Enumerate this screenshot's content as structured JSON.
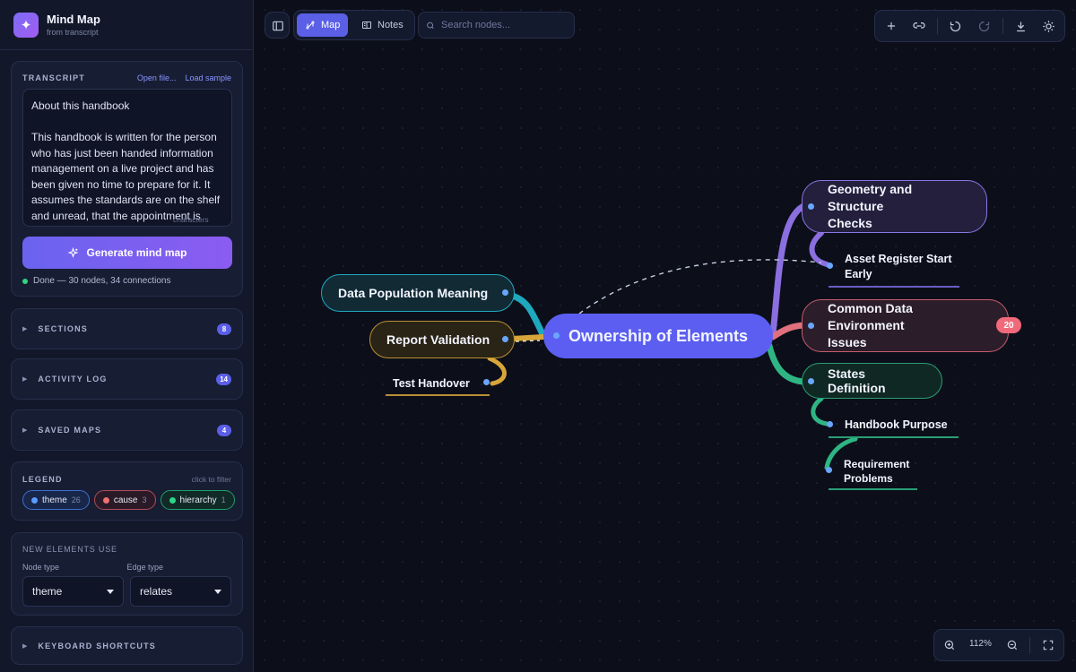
{
  "app": {
    "title": "Mind Map",
    "subtitle": "from transcript"
  },
  "transcript": {
    "label": "TRANSCRIPT",
    "open_file": "Open file...",
    "load_sample": "Load sample",
    "text": "About this handbook\n\nThis handbook is written for the person who has just been handed information management on a live project and has been given no time to prepare for it. It assumes the standards are on the shelf and unread, that the appointment is",
    "char_count": "characters",
    "generate_label": "Generate mind map",
    "status": "Done — 30 nodes, 34 connections"
  },
  "sections": [
    {
      "label": "SECTIONS",
      "count": "8"
    },
    {
      "label": "ACTIVITY LOG",
      "count": "14"
    },
    {
      "label": "SAVED MAPS",
      "count": "4"
    }
  ],
  "legend": {
    "label": "LEGEND",
    "hint": "click to filter",
    "items": [
      {
        "label": "theme",
        "count": "26",
        "color": "#5b9cff"
      },
      {
        "label": "cause",
        "count": "3",
        "color": "#f07070"
      },
      {
        "label": "hierarchy",
        "count": "1",
        "color": "#2fd58a"
      }
    ]
  },
  "new_elements": {
    "label": "NEW ELEMENTS USE",
    "node_type_label": "Node type",
    "edge_type_label": "Edge type",
    "node_type_value": "theme",
    "edge_type_value": "relates"
  },
  "shortcuts": {
    "label": "KEYBOARD SHORTCUTS"
  },
  "toolbar": {
    "map_label": "Map",
    "notes_label": "Notes",
    "search_placeholder": "Search nodes...",
    "zoom": "112%"
  },
  "map": {
    "center": "Ownership of Elements",
    "left": {
      "data_population": "Data Population Meaning",
      "report_validation": "Report Validation",
      "test_handover": "Test Handover"
    },
    "right": {
      "geometry_l1": "Geometry and Structure",
      "geometry_l2": "Checks",
      "asset_l1": "Asset Register Start",
      "asset_l2": "Early",
      "cde_l1": "Common Data Environment",
      "cde_l2": "Issues",
      "cde_badge": "20",
      "states": "States Definition",
      "handbook": "Handbook Purpose",
      "req_l1": "Requirement",
      "req_l2": "Problems"
    }
  },
  "colors": {
    "accent": "#6366f1",
    "purple": "#8b6fe0",
    "red": "#e0707e",
    "green": "#2fb583",
    "teal": "#25b0c0",
    "gold": "#d7a53a"
  }
}
